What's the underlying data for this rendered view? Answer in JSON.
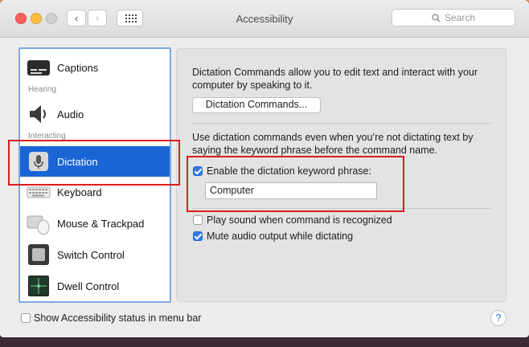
{
  "window": {
    "title": "Accessibility"
  },
  "search": {
    "placeholder": "Search"
  },
  "sidebar": {
    "items": [
      {
        "label": "Captions"
      },
      {
        "label": "Audio"
      },
      {
        "label": "Dictation"
      },
      {
        "label": "Keyboard"
      },
      {
        "label": "Mouse & Trackpad"
      },
      {
        "label": "Switch Control"
      },
      {
        "label": "Dwell Control"
      }
    ],
    "headers": {
      "hearing": "Hearing",
      "interacting": "Interacting"
    }
  },
  "content": {
    "intro": "Dictation Commands allow you to edit text and interact with your computer by speaking to it.",
    "commands_button": "Dictation Commands...",
    "keyword_desc": "Use dictation commands even when you’re not dictating text by saying the keyword phrase before the command name.",
    "enable_keyword_label": "Enable the dictation keyword phrase:",
    "enable_keyword_checked": true,
    "keyword_value": "Computer",
    "play_sound_label": "Play sound when command is recognized",
    "play_sound_checked": false,
    "mute_audio_label": "Mute audio output while dictating",
    "mute_audio_checked": true
  },
  "footer": {
    "status_label": "Show Accessibility status in menu bar",
    "status_checked": false,
    "help_label": "?"
  },
  "colors": {
    "selection": "#1a65d4",
    "checkbox": "#2f7ae5",
    "annotation": "#d81e1e"
  }
}
